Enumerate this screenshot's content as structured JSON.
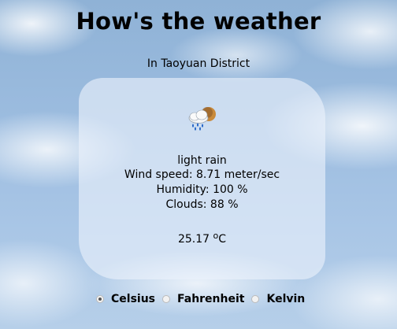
{
  "header": {
    "title": "How's the weather",
    "location": "In Taoyuan District"
  },
  "weather": {
    "icon": "light-rain-icon",
    "description": "light rain",
    "wind": "Wind speed: 8.71 meter/sec",
    "humidity": "Humidity: 100 %",
    "clouds": "Clouds: 88 %",
    "temperature_value": "25.17 ",
    "temperature_unit": "C",
    "temperature_degree": "o"
  },
  "units": {
    "options": [
      "Celsius",
      "Fahrenheit",
      "Kelvin"
    ],
    "selected": "Celsius"
  }
}
